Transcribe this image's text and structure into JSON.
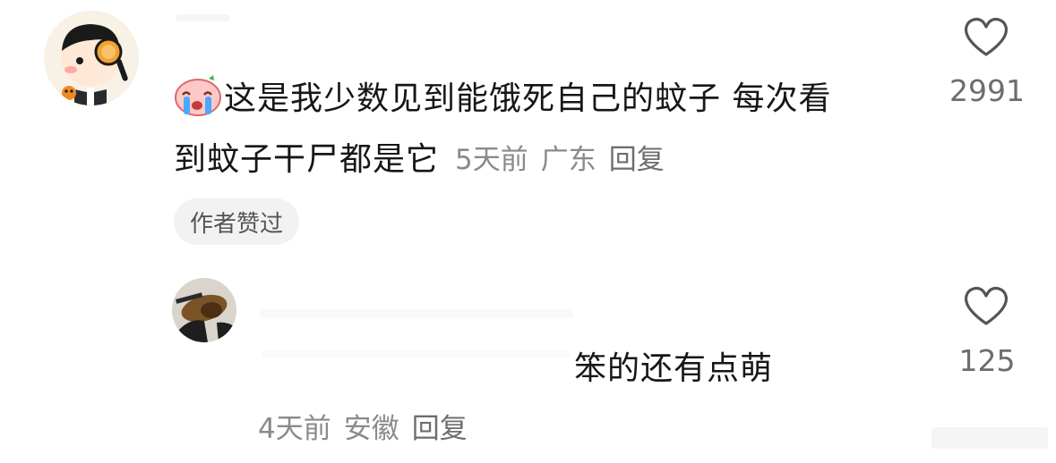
{
  "comments": [
    {
      "text_line1": "这是我少数见到能饿死自己的蚊子 每次看",
      "text_line2": "到蚊子干尸都是它",
      "time": "5天前",
      "location": "广东",
      "reply_label": "回复",
      "badge": "作者赞过",
      "likes": "2991",
      "emoji_icon": "crying-emoji-icon"
    },
    {
      "text": "笨的还有点萌",
      "time": "4天前",
      "location": "安徽",
      "reply_label": "回复",
      "likes": "125"
    }
  ],
  "colors": {
    "text": "#161616",
    "meta": "#8a8a8a",
    "badge_bg": "#f2f2f2",
    "heart": "#555555"
  }
}
